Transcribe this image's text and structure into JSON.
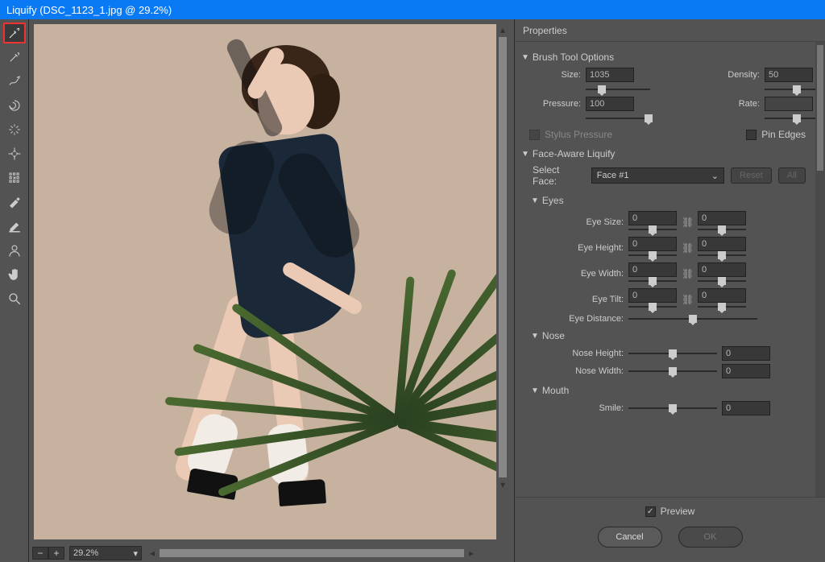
{
  "title": "Liquify (DSC_1123_1.jpg @ 29.2%)",
  "zoom": "29.2%",
  "properties": {
    "header": "Properties",
    "brush_section": "Brush Tool Options",
    "size_label": "Size:",
    "size_value": "1035",
    "density_label": "Density:",
    "density_value": "50",
    "pressure_label": "Pressure:",
    "pressure_value": "100",
    "rate_label": "Rate:",
    "rate_value": "",
    "stylus_label": "Stylus Pressure",
    "pin_edges_label": "Pin Edges",
    "face_section": "Face-Aware Liquify",
    "select_face_label": "Select Face:",
    "select_face_value": "Face #1",
    "reset_label": "Reset",
    "all_label": "All",
    "eyes_section": "Eyes",
    "eye_size_label": "Eye Size:",
    "eye_size_l": "0",
    "eye_size_r": "0",
    "eye_height_label": "Eye Height:",
    "eye_height_l": "0",
    "eye_height_r": "0",
    "eye_width_label": "Eye Width:",
    "eye_width_l": "0",
    "eye_width_r": "0",
    "eye_tilt_label": "Eye Tilt:",
    "eye_tilt_l": "0",
    "eye_tilt_r": "0",
    "eye_distance_label": "Eye Distance:",
    "nose_section": "Nose",
    "nose_height_label": "Nose Height:",
    "nose_height_v": "0",
    "nose_width_label": "Nose Width:",
    "nose_width_v": "0",
    "mouth_section": "Mouth",
    "smile_label": "Smile:",
    "smile_v": "0",
    "preview_label": "Preview",
    "cancel_label": "Cancel",
    "ok_label": "OK"
  }
}
